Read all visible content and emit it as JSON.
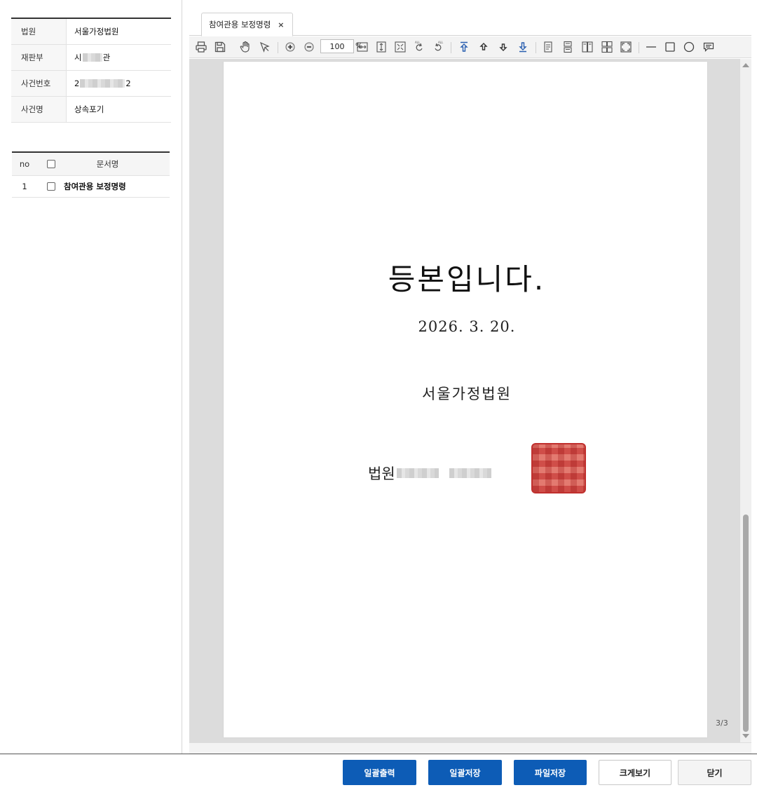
{
  "case_info": {
    "rows": [
      {
        "label": "법원",
        "value": "서울가정법원"
      },
      {
        "label": "재판부",
        "value_prefix": "시",
        "value_suffix": "관"
      },
      {
        "label": "사건번호",
        "value_prefix": "2",
        "value_suffix": "2"
      },
      {
        "label": "사건명",
        "value": "상속포기"
      }
    ]
  },
  "doc_list": {
    "headers": {
      "no": "no",
      "name": "문서명"
    },
    "rows": [
      {
        "no": "1",
        "name": "참여관용 보정명령"
      }
    ]
  },
  "viewer": {
    "tab_label": "참여관용 보정명령",
    "tab_close": "×",
    "zoom_value": "100",
    "zoom_unit": "%",
    "page_indicator": "3/3"
  },
  "document": {
    "certification": "등본입니다.",
    "date": "2026. 3. 20.",
    "court": "서울가정법원",
    "officer_prefix": "법원"
  },
  "buttons": {
    "bulk_print": "일괄출력",
    "bulk_save": "일괄저장",
    "file_save": "파일저장",
    "enlarge": "크게보기",
    "close": "닫기"
  },
  "colors": {
    "primary_button": "#0d5cb6",
    "seal_red": "#c0302e"
  }
}
